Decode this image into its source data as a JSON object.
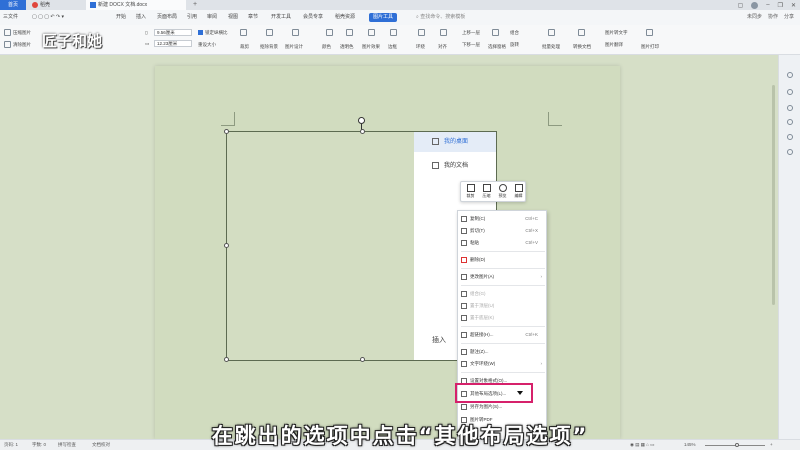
{
  "tabs": {
    "home": "首页",
    "daoke": "稻壳",
    "doc": "新建 DOCX 文档.docx",
    "add": "+"
  },
  "menu": {
    "file": "三文件",
    "items": [
      "开始",
      "插入",
      "页面布局",
      "引用",
      "审阅",
      "视图",
      "章节",
      "开发工具",
      "会员专享",
      "稻壳资源"
    ],
    "active": "图片工具",
    "search": "查找命令、搜索模板",
    "right": [
      "未同步",
      "协作",
      "分享"
    ]
  },
  "ribbon": {
    "compress": "压缩图片",
    "clear": "清除图片",
    "height": "9.56厘米",
    "width": "12.23厘米",
    "lock_ratio": "锁定纵横比",
    "reset_size": "重设大小",
    "crop": "裁剪",
    "items": [
      "抠除背景",
      "图片设计",
      "颜色",
      "透明色",
      "图片效果",
      "边框",
      "环绕",
      "对齐",
      "上移一层",
      "下移一层",
      "选择窗格",
      "组合",
      "旋转",
      "批量处理",
      "转换文档",
      "图片转文字",
      "图片翻译",
      "图片打印"
    ]
  },
  "watermark_logo": "匠子和她",
  "explorer": {
    "item1": "我的桌面",
    "item2": "我的文档",
    "insert": "插入"
  },
  "floatbar": [
    "裁剪",
    "压缩",
    "预览",
    "编辑"
  ],
  "context_menu": {
    "items": [
      {
        "label": "复制(C)",
        "shortcut": "Ctrl+C"
      },
      {
        "label": "剪切(T)",
        "shortcut": "Ctrl+X"
      },
      {
        "label": "粘贴",
        "shortcut": "Ctrl+V"
      },
      {
        "label": "删除(D)",
        "shortcut": ""
      },
      {
        "label": "更改图片(A)",
        "shortcut": ""
      },
      {
        "label": "组合(G)",
        "shortcut": ""
      },
      {
        "label": "置于顶层(U)",
        "shortcut": ""
      },
      {
        "label": "置于底层(K)",
        "shortcut": ""
      },
      {
        "label": "超链接(H)...",
        "shortcut": "Ctrl+K"
      },
      {
        "label": "题注(Z)...",
        "shortcut": ""
      },
      {
        "label": "文字环绕(W)",
        "shortcut": ""
      },
      {
        "label": "设置对象格式(O)...",
        "shortcut": ""
      },
      {
        "label": "其他布局选项(L)...",
        "shortcut": ""
      },
      {
        "label": "另存为图片(S)...",
        "shortcut": ""
      },
      {
        "label": "图片转PDF",
        "shortcut": ""
      }
    ]
  },
  "statusbar": {
    "page": "页码: 1",
    "words": "字数: 0",
    "spell": "拼写检查",
    "compat": "文档校对",
    "zoom": "145%"
  },
  "subtitle": "在跳出的选项中点击“其他布局选项”",
  "colors": {
    "accent": "#2f6fd6",
    "highlight": "#d6216b",
    "page_bg": "#d1dcbf"
  }
}
